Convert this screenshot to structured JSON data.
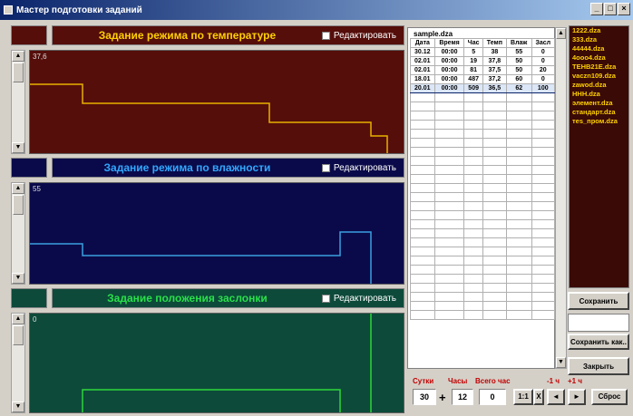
{
  "window": {
    "title": "Мастер подготовки заданий",
    "minimize": "_",
    "maximize": "□",
    "close": "×"
  },
  "panels": {
    "temperature": {
      "title": "Задание режима по температуре",
      "edit_label": "Редактировать",
      "value": "37,6",
      "bg": "#550e0a",
      "title_color": "#ffd000",
      "line_color": "#e8b000"
    },
    "humidity": {
      "title": "Задание режима по влажности",
      "edit_label": "Редактировать",
      "value": "55",
      "bg": "#0a0a4a",
      "title_color": "#31a8ff",
      "line_color": "#3a9fe0"
    },
    "damper": {
      "title": "Задание положения заслонки",
      "edit_label": "Редактировать",
      "value": "0",
      "bg": "#0d4a3a",
      "title_color": "#29e04a",
      "line_color": "#2fd63a"
    }
  },
  "schedule": {
    "file": "sample.dza",
    "columns": [
      "Дата",
      "Время",
      "Час",
      "Темп",
      "Влаж",
      "Засл"
    ],
    "rows": [
      [
        "30.12",
        "00:00",
        "5",
        "38",
        "55",
        "0"
      ],
      [
        "02.01",
        "00:00",
        "19",
        "37,8",
        "50",
        "0"
      ],
      [
        "02.01",
        "00:00",
        "81",
        "37,5",
        "50",
        "20"
      ],
      [
        "18.01",
        "00:00",
        "487",
        "37,2",
        "60",
        "0"
      ],
      [
        "20.01",
        "00:00",
        "509",
        "36,5",
        "62",
        "100"
      ]
    ],
    "selected_row": 4
  },
  "files": [
    "1222.dza",
    "333.dza",
    "44444.dza",
    "4ooo4.dza",
    "TEHB21E.dza",
    "vaczn109.dza",
    "zawod.dza",
    "HHH.dza",
    "элемент.dza",
    "стандарт.dza",
    "тes_пром.dza"
  ],
  "buttons": {
    "save": "Сохранить",
    "save_as": "Сохранить как..",
    "close": "Закрыть",
    "reset": "Сброс",
    "step_back": "-1 ч",
    "step_fwd": "+1 ч",
    "scale_one": "1:1",
    "scale_x": "X",
    "prev": "◄",
    "next": "►"
  },
  "bottom": {
    "days_label": "Сутки",
    "hours_label": "Часы",
    "total_label": "Всего час",
    "days": "30",
    "hours": "12",
    "total": "0",
    "plus": "+"
  }
}
